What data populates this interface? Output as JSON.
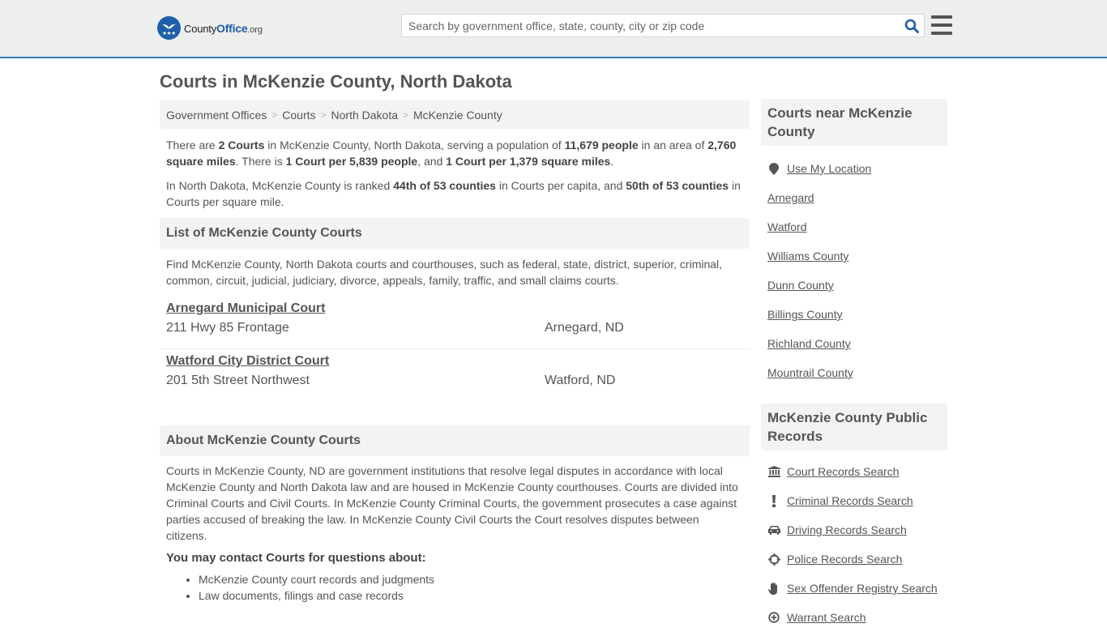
{
  "header": {
    "logo": {
      "text_main": "County",
      "text_accent": "Office",
      "text_suffix": ".org"
    },
    "search": {
      "placeholder": "Search by government office, state, county, city or zip code",
      "value": ""
    },
    "icons": {
      "search": "search-icon",
      "menu": "hamburger-menu-icon"
    },
    "accent_color": "#337ab7"
  },
  "page": {
    "title": "Courts in McKenzie County, North Dakota"
  },
  "breadcrumb": [
    {
      "label": "Government Offices"
    },
    {
      "label": "Courts"
    },
    {
      "label": "North Dakota"
    },
    {
      "label": "McKenzie County"
    }
  ],
  "breadcrumb_separator": ">",
  "intro": {
    "p1": {
      "t1": "There are ",
      "b1": "2 Courts",
      "t2": " in McKenzie County, North Dakota, serving a population of ",
      "b2": "11,679 people",
      "t3": " in an area of ",
      "b3": "2,760 square miles",
      "t4": ". There is ",
      "b4": "1 Court per 5,839 people",
      "t5": ", and ",
      "b5": "1 Court per 1,379 square miles",
      "t6": "."
    },
    "p2": {
      "t1": "In North Dakota, McKenzie County is ranked ",
      "b1": "44th of 53 counties",
      "t2": " in Courts per capita, and ",
      "b2": "50th of 53 counties",
      "t3": " in Courts per square mile."
    }
  },
  "list_section": {
    "heading": "List of McKenzie County Courts",
    "description": "Find McKenzie County, North Dakota courts and courthouses, such as federal, state, district, superior, criminal, common, circuit, judicial, judiciary, divorce, appeals, family, traffic, and small claims courts.",
    "courts": [
      {
        "name": "Arnegard Municipal Court",
        "address": "211 Hwy 85 Frontage",
        "city": "Arnegard, ND"
      },
      {
        "name": "Watford City District Court",
        "address": "201 5th Street Northwest",
        "city": "Watford, ND"
      }
    ]
  },
  "about_section": {
    "heading": "About McKenzie County Courts",
    "body": "Courts in McKenzie County, ND are government institutions that resolve legal disputes in accordance with local McKenzie County and North Dakota law and are housed in McKenzie County courthouses. Courts are divided into Criminal Courts and Civil Courts. In McKenzie County Criminal Courts, the government prosecutes a case against parties accused of breaking the law. In McKenzie County Civil Courts the Court resolves disputes between citizens.",
    "contact_heading": "You may contact Courts for questions about:",
    "contact_items": [
      "McKenzie County court records and judgments",
      "Law documents, filings and case records"
    ]
  },
  "sidebar": {
    "nearby": {
      "heading": "Courts near McKenzie County",
      "use_location": {
        "label": "Use My Location",
        "icon": "map-marker-icon"
      },
      "links": [
        "Arnegard",
        "Watford",
        "Williams County",
        "Dunn County",
        "Billings County",
        "Richland County",
        "Mountrail County"
      ]
    },
    "records": {
      "heading": "McKenzie County Public Records",
      "links": [
        {
          "label": "Court Records Search",
          "icon": "courthouse-icon"
        },
        {
          "label": "Criminal Records Search",
          "icon": "exclamation-icon"
        },
        {
          "label": "Driving Records Search",
          "icon": "car-icon"
        },
        {
          "label": "Police Records Search",
          "icon": "crosshair-icon"
        },
        {
          "label": "Sex Offender Registry Search",
          "icon": "hand-icon"
        },
        {
          "label": "Warrant Search",
          "icon": "plus-circle-icon"
        }
      ]
    }
  }
}
